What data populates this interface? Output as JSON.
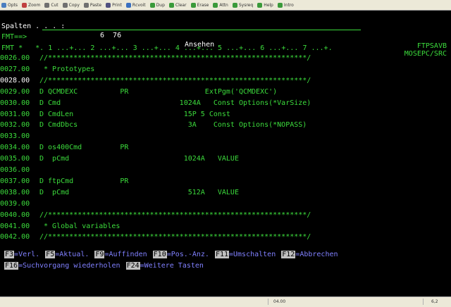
{
  "toolbar": {
    "items": [
      {
        "label": "Opts",
        "icon": "options-icon",
        "color": "#4a7ec0"
      },
      {
        "label": "Zoom",
        "icon": "zoom-icon",
        "color": "#c04040"
      },
      {
        "label": "Cut",
        "icon": "cut-icon",
        "color": "#707070"
      },
      {
        "label": "Copy",
        "icon": "copy-icon",
        "color": "#707070"
      },
      {
        "label": "Paste",
        "icon": "paste-icon",
        "color": "#707070"
      },
      {
        "label": "Print",
        "icon": "print-icon",
        "color": "#505080"
      },
      {
        "label": "Rcvoit",
        "icon": "receive-icon",
        "color": "#3a70c0"
      },
      {
        "label": "Dup",
        "icon": "dup-icon",
        "color": "#3a9a3a"
      },
      {
        "label": "Clear",
        "icon": "clear-icon",
        "color": "#3a9a3a"
      },
      {
        "label": "Erase",
        "icon": "erase-icon",
        "color": "#3a9a3a"
      },
      {
        "label": "Attn",
        "icon": "attn-icon",
        "color": "#3a9a3a"
      },
      {
        "label": "Sysreq",
        "icon": "sysreq-icon",
        "color": "#3a9a3a"
      },
      {
        "label": "Help",
        "icon": "help-icon",
        "color": "#3a9a3a"
      },
      {
        "label": "Intro",
        "icon": "intro-icon",
        "color": "#3a9a3a"
      }
    ]
  },
  "header": {
    "spalten": "Spalten . . . :",
    "cols": "6  76",
    "mode": "Ansehen",
    "member": "MOSEPC/SRC",
    "prompt": "FMT==>",
    "file": "FTPSAVB",
    "ruler": "FMT *   *. 1 ...+... 2 ...+... 3 ...+... 4 ...+... 5 ...+... 6 ...+... 7 ...+."
  },
  "source_lines": [
    {
      "num": "0026.00",
      "text": "//*************************************************************/",
      "current": false
    },
    {
      "num": "0027.00",
      "text": " * Prototypes",
      "current": false
    },
    {
      "num": "0028.00",
      "text": "//*************************************************************/",
      "current": true
    },
    {
      "num": "0029.00",
      "text": "D QCMDEXC          PR                  ExtPgm('QCMDEXC')",
      "current": false
    },
    {
      "num": "0030.00",
      "text": "D Cmd                            1024A   Const Options(*VarSize)",
      "current": false
    },
    {
      "num": "0031.00",
      "text": "D CmdLen                          15P 5 Const",
      "current": false
    },
    {
      "num": "0032.00",
      "text": "D CmdDbcs                          3A    Const Options(*NOPASS)",
      "current": false
    },
    {
      "num": "0033.00",
      "text": "",
      "current": false
    },
    {
      "num": "0034.00",
      "text": "D os400Cmd         PR",
      "current": false
    },
    {
      "num": "0035.00",
      "text": "D  pCmd                           1024A   VALUE",
      "current": false
    },
    {
      "num": "0036.00",
      "text": "",
      "current": false
    },
    {
      "num": "0037.00",
      "text": "D ftpCmd           PR",
      "current": false
    },
    {
      "num": "0038.00",
      "text": "D  pCmd                            512A   VALUE",
      "current": false
    },
    {
      "num": "0039.00",
      "text": "",
      "current": false
    },
    {
      "num": "0040.00",
      "text": "//*************************************************************/",
      "current": false
    },
    {
      "num": "0041.00",
      "text": " * Global variables",
      "current": false
    },
    {
      "num": "0042.00",
      "text": "//*************************************************************/",
      "current": false
    }
  ],
  "function_keys": [
    [
      {
        "key": "F3",
        "label": "=Verl."
      },
      {
        "key": "F5",
        "label": "=Aktual."
      },
      {
        "key": "F9",
        "label": "=Auffinden"
      },
      {
        "key": "F10",
        "label": "=Pos.-Anz."
      },
      {
        "key": "F11",
        "label": "=Umschalten"
      },
      {
        "key": "F12",
        "label": "=Abbrechen"
      }
    ],
    [
      {
        "key": "F16",
        "label": "=Suchvorgang wiederholen"
      },
      {
        "key": "F24",
        "label": "=Weitere Tasten"
      }
    ]
  ],
  "status": {
    "session": "04.00",
    "position": "6,2"
  },
  "colors": {
    "screen_bg": "#000000",
    "text_green": "#3cdc3c",
    "text_white": "#ffffff",
    "text_blue": "#8080ff"
  }
}
